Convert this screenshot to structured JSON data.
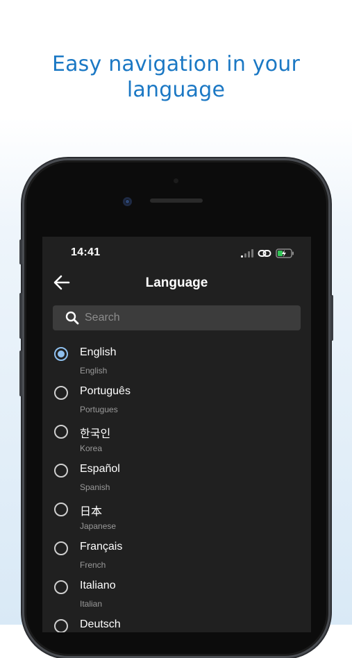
{
  "headline": "Easy navigation in your language",
  "status_bar": {
    "time": "14:41",
    "icons": [
      "cellular-signal-icon",
      "link-icon",
      "battery-charging-icon"
    ]
  },
  "top_bar": {
    "title": "Language",
    "back_icon": "arrow-left-icon"
  },
  "search": {
    "placeholder": "Search",
    "value": "",
    "icon": "search-icon"
  },
  "languages": [
    {
      "name": "English",
      "sub": "English",
      "selected": true
    },
    {
      "name": "Português",
      "sub": "Portugues",
      "selected": false
    },
    {
      "name": "한국인",
      "sub": "Korea",
      "selected": false
    },
    {
      "name": "Español",
      "sub": "Spanish",
      "selected": false
    },
    {
      "name": "日本",
      "sub": "Japanese",
      "selected": false
    },
    {
      "name": "Français",
      "sub": "French",
      "selected": false
    },
    {
      "name": "Italiano",
      "sub": "Italian",
      "selected": false
    },
    {
      "name": "Deutsch",
      "sub": "",
      "selected": false
    }
  ],
  "colors": {
    "accent": "#8fc0ee",
    "headline": "#1b78c4",
    "screen_bg": "#202020",
    "battery": "#34c759"
  }
}
